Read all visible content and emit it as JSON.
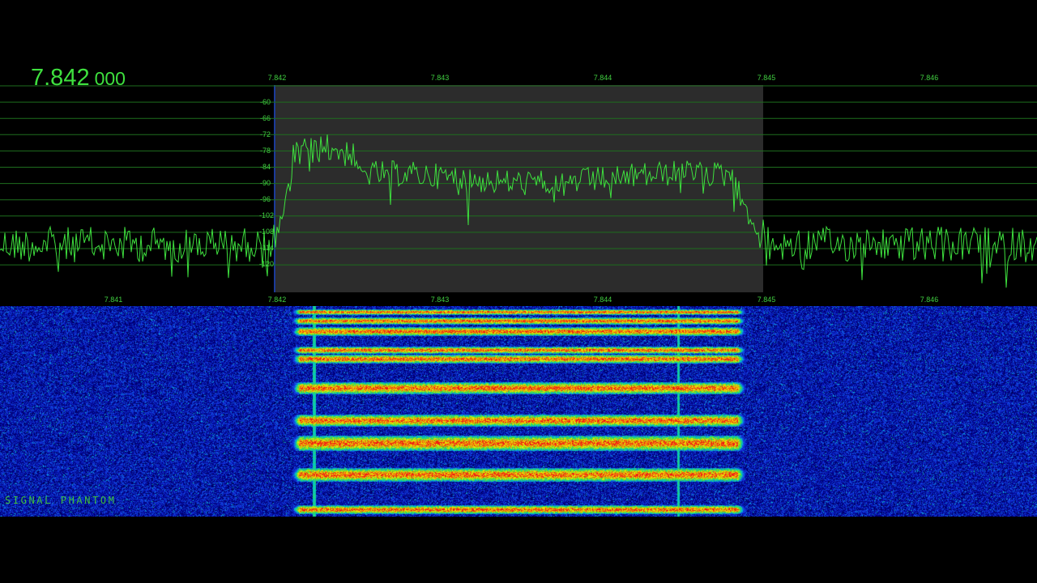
{
  "frequency_display": {
    "main": "7.842",
    "sub": "000"
  },
  "spectrum": {
    "top_axis_ticks": [
      "7.842",
      "7.843",
      "7.844",
      "7.845",
      "7.846"
    ],
    "bottom_axis_ticks": [
      "7.841",
      "7.842",
      "7.843",
      "7.844",
      "7.845",
      "7.846"
    ],
    "db_labels": [
      "-60",
      "-66",
      "-72",
      "-78",
      "-84",
      "-90",
      "-96",
      "-102",
      "-108",
      "-114",
      "-120"
    ],
    "passband_shade_color": "#2c2c2c",
    "trace_color": "#3ee03e",
    "grid_color": "#1e7a1e"
  },
  "waterfall": {
    "background_color": "#000066"
  },
  "watermark": {
    "text": "SIGNAL PHANTOM"
  }
}
